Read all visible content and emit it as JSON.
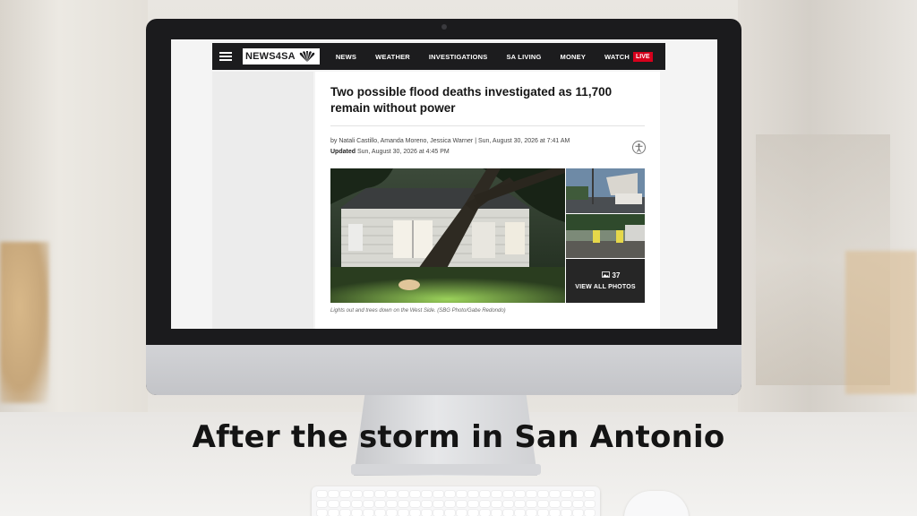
{
  "site": {
    "logo_text": "NEWS4SA",
    "nav": [
      "NEWS",
      "WEATHER",
      "INVESTIGATIONS",
      "SA LIVING",
      "MONEY",
      "WATCH"
    ],
    "live_label": "LIVE"
  },
  "article": {
    "headline": "Two possible flood deaths investigated as 11,700 remain without power",
    "byline": "by Natali Castillo, Amanda Moreno, Jessica Warner | Sun, August 30, 2026 at 7:41 AM",
    "updated_label": "Updated",
    "updated_time": "Sun, August 30, 2026 at 4:45 PM",
    "photo_count": "37",
    "view_all_label": "VIEW ALL PHOTOS",
    "caption": "Lights out and trees down on the West Side. (SBG Photo/Gabe Redondo)"
  },
  "overlay_title": "After the storm in San Antonio",
  "icons": {
    "menu": "hamburger-icon",
    "accessibility": "accessibility-icon",
    "gallery": "image-icon",
    "brand": "peacock-icon"
  },
  "colors": {
    "navbar": "#1c1c1e",
    "live": "#d6001c",
    "text": "#151515"
  }
}
